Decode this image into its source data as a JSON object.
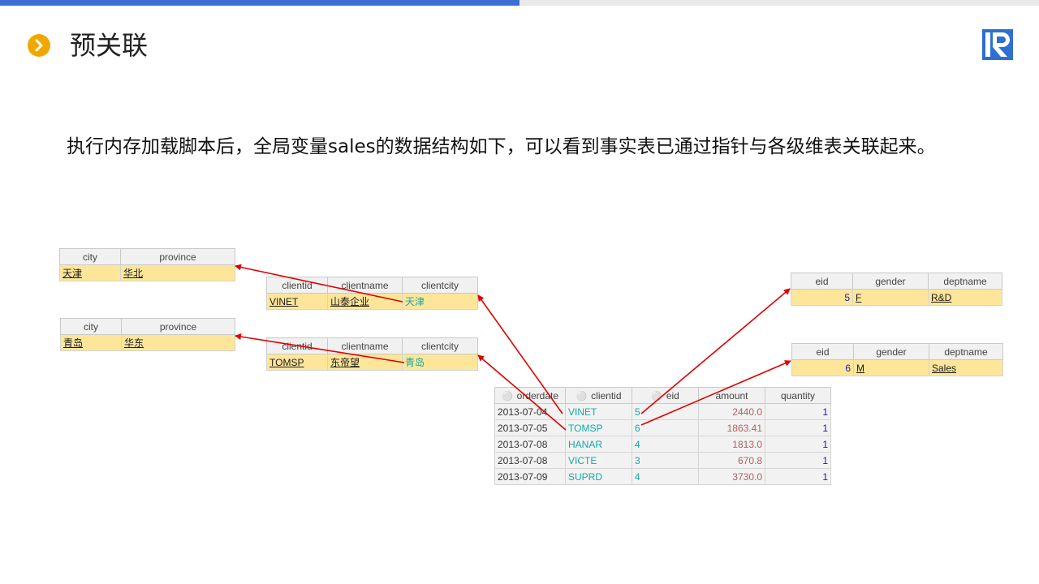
{
  "slide": {
    "title": "预关联",
    "description": "执行内存加载脚本后，全局变量sales的数据结构如下，可以看到事实表已通过指针与各级维表关联起来。"
  },
  "city_table_1": {
    "headers": [
      "city",
      "province"
    ],
    "row": {
      "city": "天津",
      "province": "华北"
    }
  },
  "city_table_2": {
    "headers": [
      "city",
      "province"
    ],
    "row": {
      "city": "青岛",
      "province": "华东"
    }
  },
  "client_table_1": {
    "headers": [
      "clientid",
      "clientname",
      "clientcity"
    ],
    "row": {
      "clientid": "VINET",
      "clientname": "山泰企业",
      "clientcity": "天津"
    }
  },
  "client_table_2": {
    "headers": [
      "clientid",
      "clientname",
      "clientcity"
    ],
    "row": {
      "clientid": "TOMSP",
      "clientname": "东帝望",
      "clientcity": "青岛"
    }
  },
  "employee_table_1": {
    "headers": [
      "eid",
      "gender",
      "deptname"
    ],
    "row": {
      "eid": "5",
      "gender": "F",
      "deptname": "R&D"
    }
  },
  "employee_table_2": {
    "headers": [
      "eid",
      "gender",
      "deptname"
    ],
    "row": {
      "eid": "6",
      "gender": "M",
      "deptname": "Sales"
    }
  },
  "sales_table": {
    "headers": [
      "orderdate",
      "clientid",
      "eid",
      "amount",
      "quantity"
    ],
    "rows": [
      {
        "orderdate": "2013-07-04",
        "clientid": "VINET",
        "eid": "5",
        "amount": "2440.0",
        "quantity": "1"
      },
      {
        "orderdate": "2013-07-05",
        "clientid": "TOMSP",
        "eid": "6",
        "amount": "1863.41",
        "quantity": "1"
      },
      {
        "orderdate": "2013-07-08",
        "clientid": "HANAR",
        "eid": "4",
        "amount": "1813.0",
        "quantity": "1"
      },
      {
        "orderdate": "2013-07-08",
        "clientid": "VICTE",
        "eid": "3",
        "amount": "670.8",
        "quantity": "1"
      },
      {
        "orderdate": "2013-07-09",
        "clientid": "SUPRD",
        "eid": "4",
        "amount": "3730.0",
        "quantity": "1"
      }
    ]
  },
  "colors": {
    "accent_blue": "#3b6fd4",
    "bullet_orange": "#f0a800",
    "arrow_red": "#e00000",
    "row_yellow": "#fde69a"
  }
}
